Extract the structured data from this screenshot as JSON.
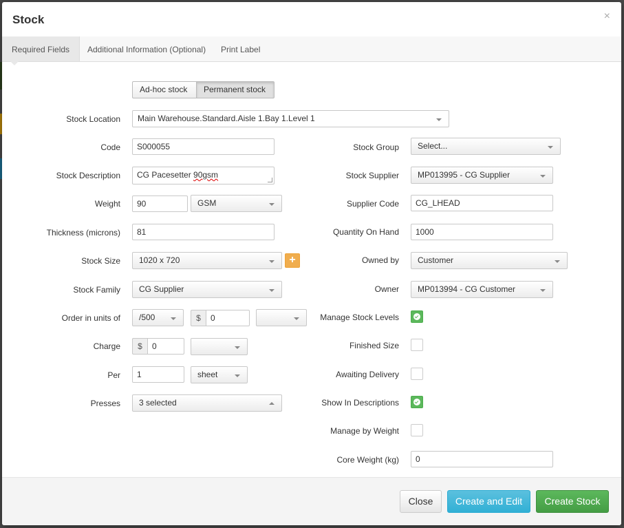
{
  "modal": {
    "title": "Stock",
    "close_symbol": "×"
  },
  "tabs": [
    {
      "label": "Required Fields",
      "active": true
    },
    {
      "label": "Additional Information (Optional)",
      "active": false
    },
    {
      "label": "Print Label",
      "active": false
    }
  ],
  "stock_type": {
    "options": [
      "Ad-hoc stock",
      "Permanent stock"
    ],
    "selected": "Permanent stock"
  },
  "left": {
    "stock_location": {
      "label": "Stock Location",
      "value": "Main Warehouse.Standard.Aisle 1.Bay 1.Level 1"
    },
    "code": {
      "label": "Code",
      "value": "S000055"
    },
    "stock_description": {
      "label": "Stock Description",
      "value_plain": "CG Pacesetter ",
      "value_misspelled": "90gsm"
    },
    "weight": {
      "label": "Weight",
      "value": "90",
      "unit": "GSM"
    },
    "thickness": {
      "label": "Thickness (microns)",
      "value": "81"
    },
    "stock_size": {
      "label": "Stock Size",
      "value": "1020 x 720",
      "add_symbol": "+"
    },
    "stock_family": {
      "label": "Stock Family",
      "value": "CG Supplier"
    },
    "order_units": {
      "label": "Order in units of",
      "unit": "/500",
      "currency": "$",
      "amount": "0",
      "extra": ""
    },
    "charge": {
      "label": "Charge",
      "currency": "$",
      "amount": "0",
      "extra": ""
    },
    "per": {
      "label": "Per",
      "amount": "1",
      "unit": "sheet"
    },
    "presses": {
      "label": "Presses",
      "value": "3 selected"
    }
  },
  "right": {
    "stock_group": {
      "label": "Stock Group",
      "value": "Select..."
    },
    "stock_supplier": {
      "label": "Stock Supplier",
      "value": "MP013995 - CG Supplier"
    },
    "supplier_code": {
      "label": "Supplier Code",
      "value": "CG_LHEAD"
    },
    "quantity_on_hand": {
      "label": "Quantity On Hand",
      "value": "1000"
    },
    "owned_by": {
      "label": "Owned by",
      "value": "Customer"
    },
    "owner": {
      "label": "Owner",
      "value": "MP013994 - CG Customer"
    },
    "manage_stock_levels": {
      "label": "Manage Stock Levels",
      "checked": true
    },
    "finished_size": {
      "label": "Finished Size",
      "checked": false
    },
    "awaiting_delivery": {
      "label": "Awaiting Delivery",
      "checked": false
    },
    "show_in_descriptions": {
      "label": "Show In Descriptions",
      "checked": true
    },
    "manage_by_weight": {
      "label": "Manage by Weight",
      "checked": false
    },
    "core_weight": {
      "label": "Core Weight (kg)",
      "value": "0"
    }
  },
  "footer": {
    "close_label": "Close",
    "create_edit_label": "Create and Edit",
    "create_label": "Create Stock"
  },
  "colors": {
    "primary_info": "#5bc0de",
    "success": "#5cb85c",
    "warning": "#f0ad4e",
    "checkbox_on": "#5cb85c"
  }
}
